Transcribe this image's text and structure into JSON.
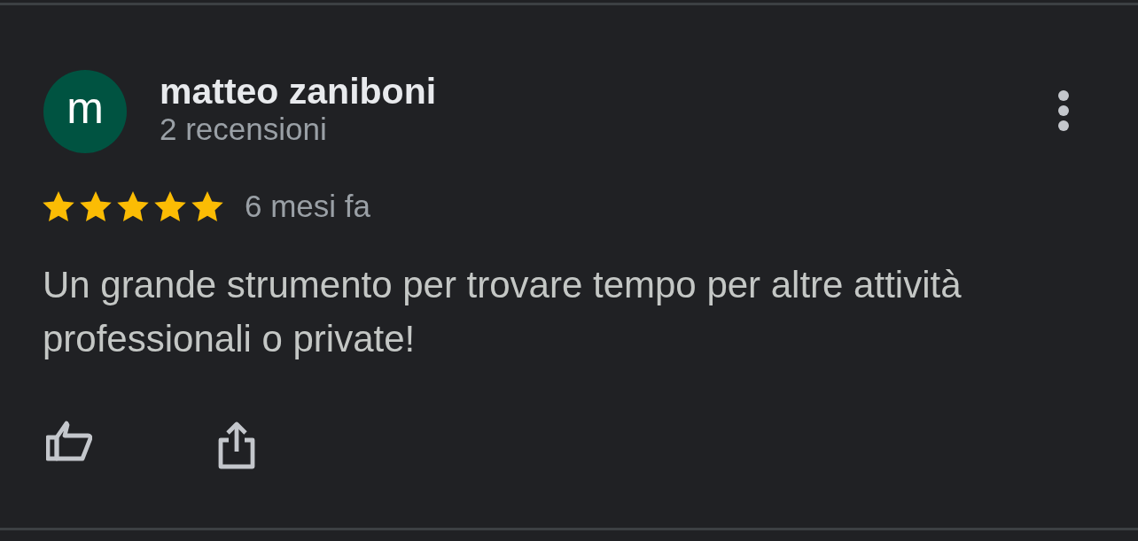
{
  "review": {
    "author": {
      "initial": "m",
      "name": "matteo zaniboni",
      "review_count": "2 recensioni"
    },
    "stars": 5,
    "time": "6 mesi fa",
    "text": "Un grande strumento per trovare tempo per altre attività professionali o private!"
  }
}
